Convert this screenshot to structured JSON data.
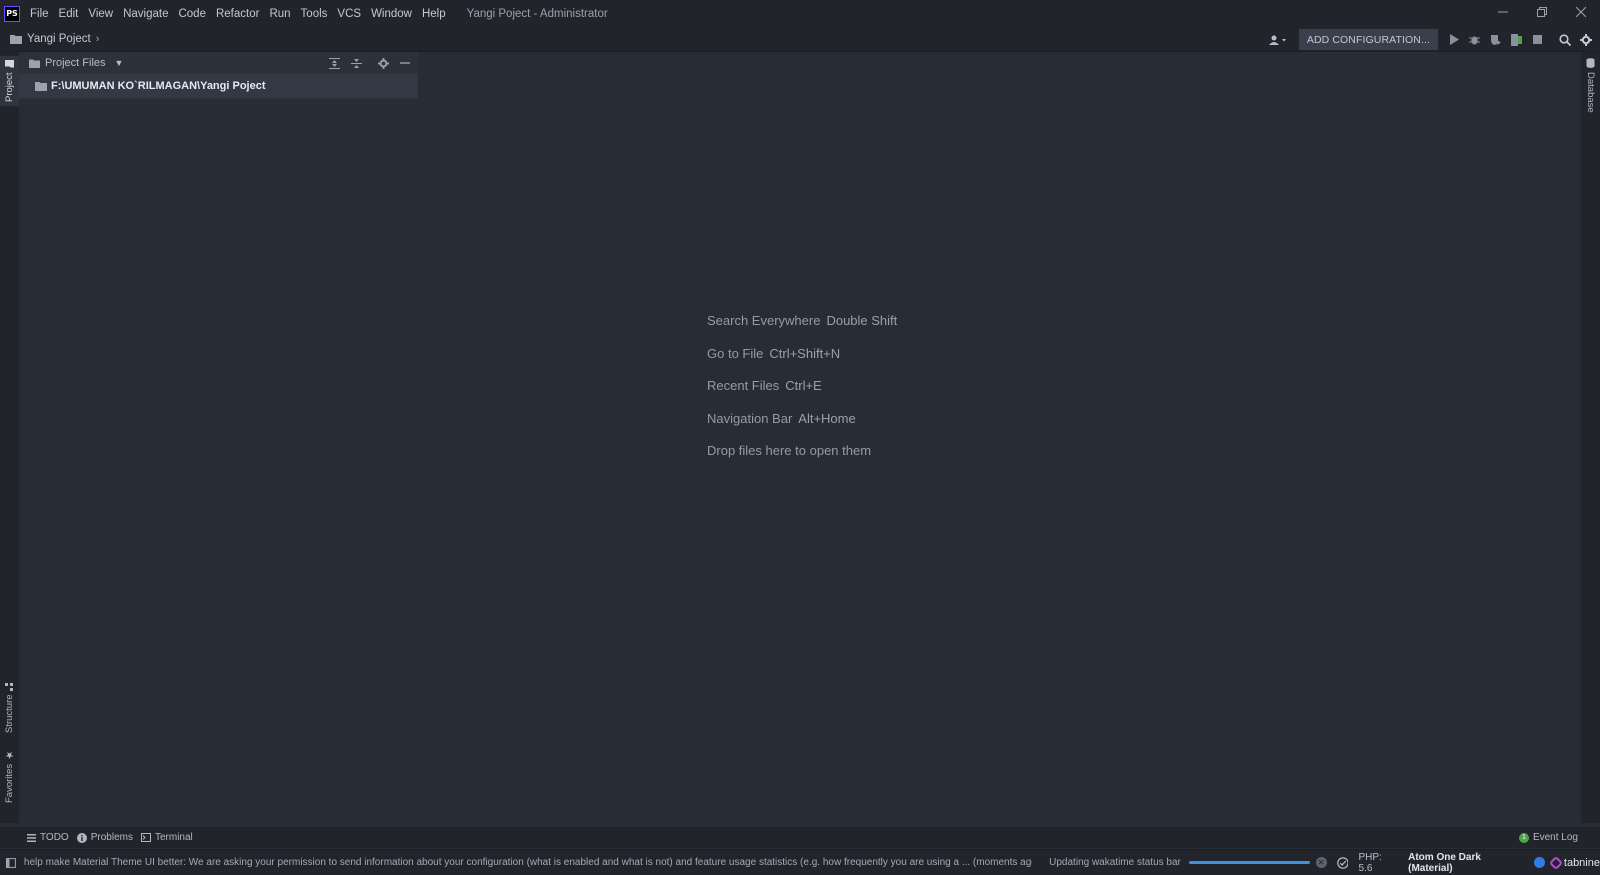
{
  "app": {
    "logo_text": "PS",
    "window_title": "Yangi Poject - Administrator"
  },
  "menu": [
    {
      "label": "File"
    },
    {
      "label": "Edit"
    },
    {
      "label": "View"
    },
    {
      "label": "Navigate"
    },
    {
      "label": "Code"
    },
    {
      "label": "Refactor"
    },
    {
      "label": "Run"
    },
    {
      "label": "Tools"
    },
    {
      "label": "VCS"
    },
    {
      "label": "Window"
    },
    {
      "label": "Help"
    }
  ],
  "navbar": {
    "breadcrumb": "Yangi Poject",
    "config_button": "ADD CONFIGURATION..."
  },
  "left_tabs": {
    "project": "Project",
    "structure": "Structure",
    "favorites": "Favorites"
  },
  "right_tabs": {
    "database": "Database"
  },
  "project_panel": {
    "title": "Project Files",
    "root_path": "F:\\UMUMAN KO`RILMAGAN\\Yangi Poject"
  },
  "editor_hints": [
    {
      "label": "Search Everywhere",
      "shortcut": "Double Shift"
    },
    {
      "label": "Go to File",
      "shortcut": "Ctrl+Shift+N"
    },
    {
      "label": "Recent Files",
      "shortcut": "Ctrl+E"
    },
    {
      "label": "Navigation Bar",
      "shortcut": "Alt+Home"
    },
    {
      "label": "Drop files here to open them",
      "shortcut": ""
    }
  ],
  "tool_windows": {
    "todo": "TODO",
    "problems": "Problems",
    "terminal": "Terminal",
    "event_log": "Event Log",
    "event_log_count": "1"
  },
  "status_bar": {
    "message": "help make Material Theme UI better: We are asking your permission to send information about your configuration (what is enabled and what is not) and feature usage statistics (e.g. how frequently you are using a ... (moments ago)",
    "wakatime": "Updating wakatime status bar",
    "progress": 1.0,
    "php": "PHP: 5.6",
    "theme": "Atom One Dark (Material)",
    "tabnine": "tabnine"
  },
  "colors": {
    "background": "#282c34",
    "chrome": "#21252b",
    "accent": "#3d8fe0",
    "event_log_badge": "#4fa34c"
  }
}
